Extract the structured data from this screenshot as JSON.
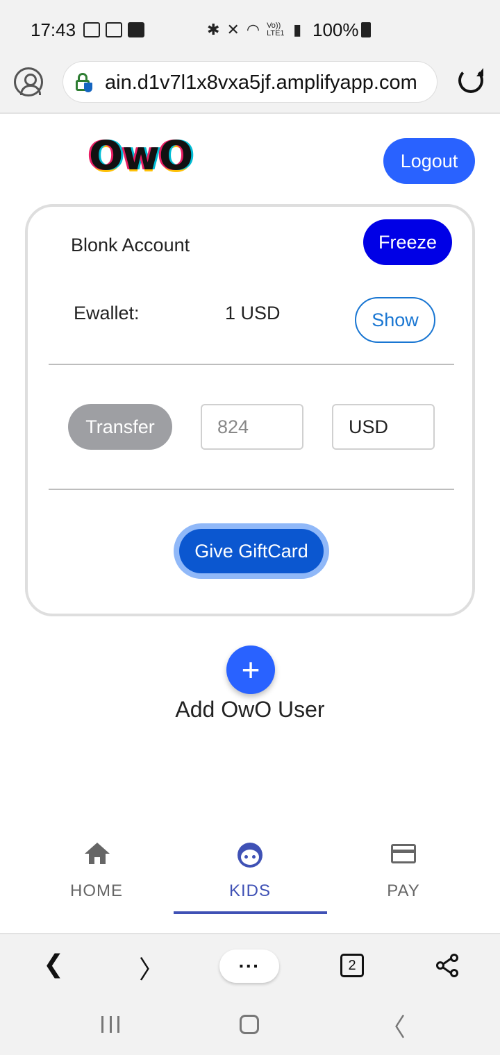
{
  "status_bar": {
    "time": "17:43",
    "signal_text": "Vo)) LTE1",
    "battery": "100%"
  },
  "browser": {
    "url": "ain.d1v7l1x8vxa5jf.amplifyapp.com",
    "tabs_count": "2",
    "menu_label": "···"
  },
  "app": {
    "logo": "OwO",
    "logout_label": "Logout"
  },
  "account_card": {
    "name": "Blonk Account",
    "freeze_label": "Freeze",
    "ewallet_label": "Ewallet:",
    "ewallet_value": "1 USD",
    "show_label": "Show",
    "transfer_label": "Transfer",
    "amount_placeholder": "824",
    "currency": "USD",
    "giftcard_label": "Give GiftCard"
  },
  "add_user": {
    "fab_symbol": "+",
    "label": "Add OwO User"
  },
  "bottom_nav": {
    "items": [
      {
        "label": "HOME",
        "icon": "home-icon"
      },
      {
        "label": "KIDS",
        "icon": "face-icon",
        "active": true
      },
      {
        "label": "PAY",
        "icon": "credit-card-icon"
      }
    ]
  },
  "colors": {
    "primary": "#2962ff",
    "freeze": "#0000e6",
    "giftcard": "#0b57d0",
    "nav_active": "#3f51b5",
    "transfer_disabled": "#9e9fa3"
  }
}
